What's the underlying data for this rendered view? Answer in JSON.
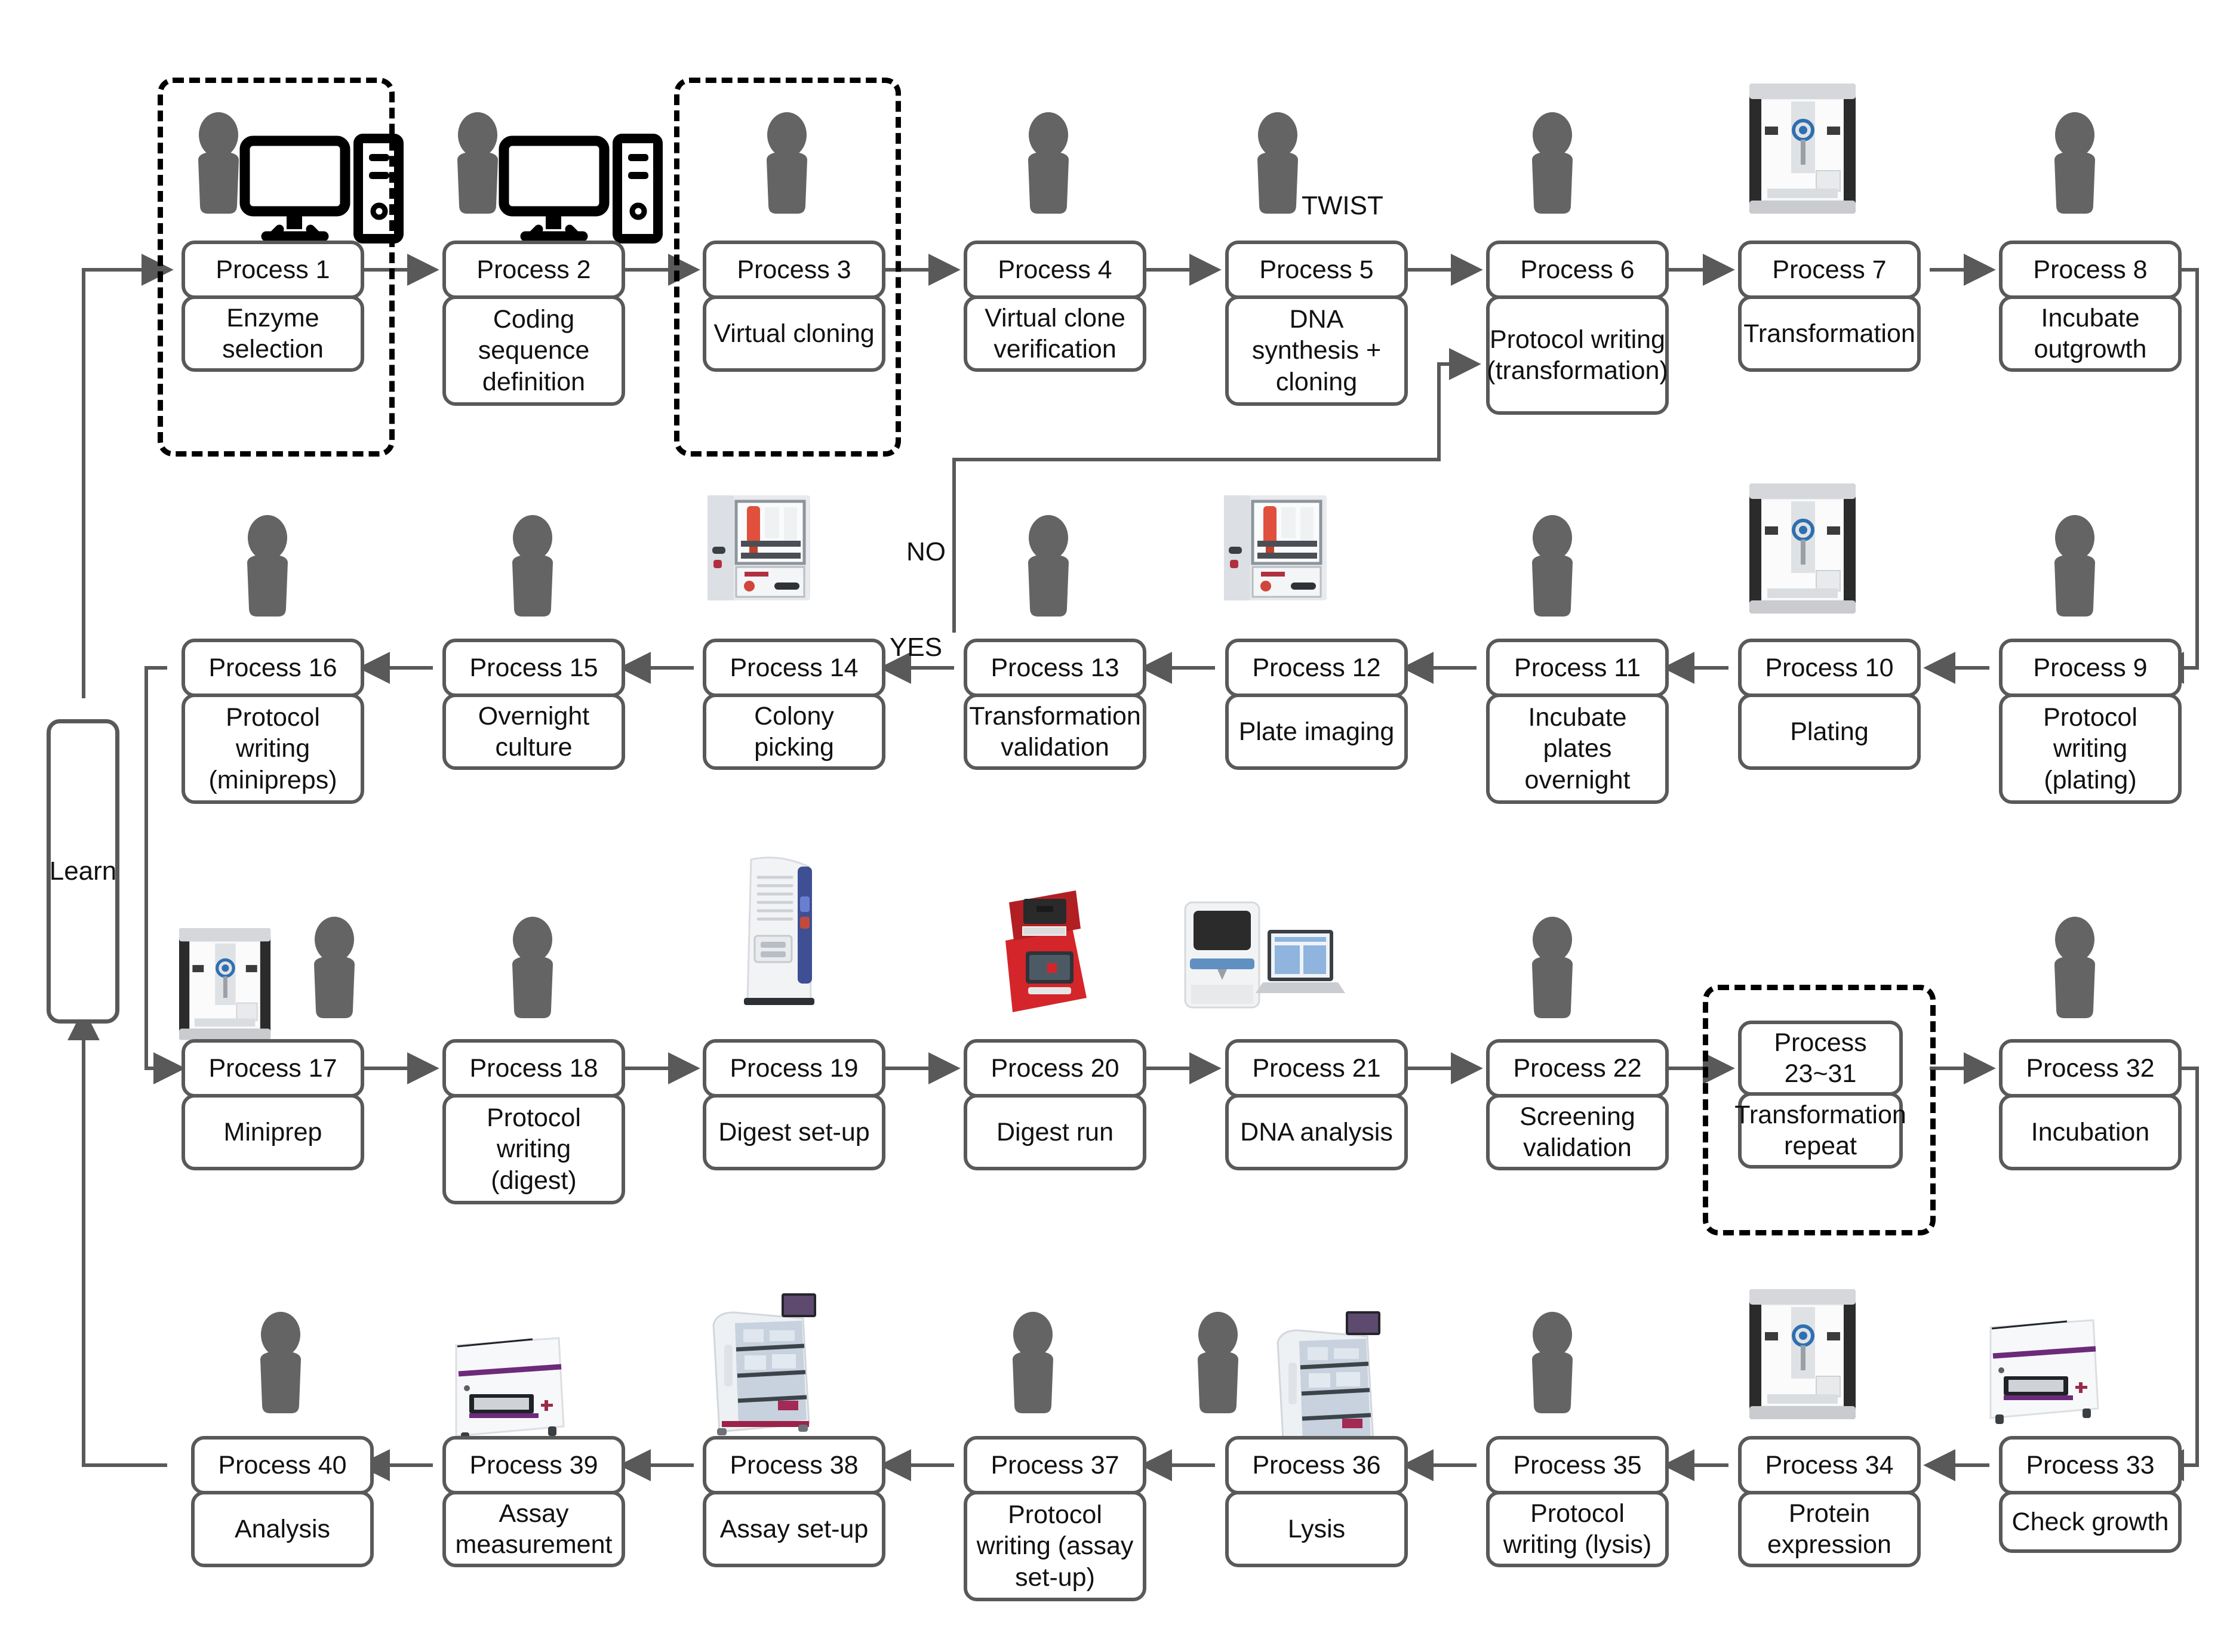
{
  "diagram": {
    "title": "Automated protein engineering workflow (Process 1 - Process 40)",
    "colors": {
      "box_border": "#595959",
      "box_fill": "#FFFFFF",
      "group_border": "#000000",
      "arrow": "#595959",
      "person_icon": "#646464",
      "text": "#111111"
    },
    "learn": {
      "label": "Learn"
    },
    "annotations": [
      {
        "id": "twist",
        "text": "TWIST"
      },
      {
        "id": "no",
        "text": "NO"
      },
      {
        "id": "yes",
        "text": "YES"
      }
    ],
    "groups": [
      {
        "id": "group-p1",
        "contains": [
          "Process 1"
        ]
      },
      {
        "id": "group-p3",
        "contains": [
          "Process 3"
        ]
      },
      {
        "id": "group-p23-31",
        "contains": [
          "Process 23~31"
        ]
      }
    ],
    "rows": [
      {
        "id": "row-1",
        "direction": "left-to-right",
        "nodes": [
          {
            "id": "p1",
            "title": "Process 1",
            "desc": "Enzyme selection",
            "actor": "person",
            "device": "computer"
          },
          {
            "id": "p2",
            "title": "Process 2",
            "desc": "Coding sequence definition",
            "actor": "person",
            "device": "computer"
          },
          {
            "id": "p3",
            "title": "Process 3",
            "desc": "Virtual cloning",
            "actor": "person",
            "device": "none"
          },
          {
            "id": "p4",
            "title": "Process 4",
            "desc": "Virtual clone verification",
            "actor": "person",
            "device": "none"
          },
          {
            "id": "p5",
            "title": "Process 5",
            "desc": "DNA synthesis + cloning",
            "actor": "person",
            "device": "none",
            "note": "TWIST"
          },
          {
            "id": "p6",
            "title": "Process 6",
            "desc": "Protocol writing (transformation)",
            "actor": "person",
            "device": "none"
          },
          {
            "id": "p7",
            "title": "Process 7",
            "desc": "Transformation",
            "actor": "none",
            "device": "opentrons"
          },
          {
            "id": "p8",
            "title": "Process 8",
            "desc": "Incubate outgrowth",
            "actor": "person",
            "device": "none"
          }
        ]
      },
      {
        "id": "row-2",
        "direction": "right-to-left",
        "nodes": [
          {
            "id": "p9",
            "title": "Process 9",
            "desc": "Protocol writing (plating)",
            "actor": "person",
            "device": "none"
          },
          {
            "id": "p10",
            "title": "Process 10",
            "desc": "Plating",
            "actor": "none",
            "device": "opentrons"
          },
          {
            "id": "p11",
            "title": "Process 11",
            "desc": "Incubate plates overnight",
            "actor": "person",
            "device": "none"
          },
          {
            "id": "p12",
            "title": "Process 12",
            "desc": "Plate imaging",
            "actor": "none",
            "device": "pixl"
          },
          {
            "id": "p13",
            "title": "Process 13",
            "desc": "Transformation validation",
            "actor": "person",
            "device": "none"
          },
          {
            "id": "p14",
            "title": "Process 14",
            "desc": "Colony picking",
            "actor": "none",
            "device": "pixl"
          },
          {
            "id": "p15",
            "title": "Process 15",
            "desc": "Overnight culture",
            "actor": "person",
            "device": "none"
          },
          {
            "id": "p16",
            "title": "Process 16",
            "desc": "Protocol writing (minipreps)",
            "actor": "person",
            "device": "none"
          }
        ]
      },
      {
        "id": "row-3",
        "direction": "left-to-right",
        "nodes": [
          {
            "id": "p17",
            "title": "Process 17",
            "desc": "Miniprep",
            "actor": "person",
            "device": "opentrons"
          },
          {
            "id": "p18",
            "title": "Process 18",
            "desc": "Protocol writing (digest)",
            "actor": "person",
            "device": "none"
          },
          {
            "id": "p19",
            "title": "Process 19",
            "desc": "Digest set-up",
            "actor": "none",
            "device": "pipette-tower"
          },
          {
            "id": "p20",
            "title": "Process 20",
            "desc": "Digest run",
            "actor": "none",
            "device": "thermocycler"
          },
          {
            "id": "p21",
            "title": "Process 21",
            "desc": "DNA analysis",
            "actor": "none",
            "device": "analyzer-laptop"
          },
          {
            "id": "p22",
            "title": "Process 22",
            "desc": "Screening validation",
            "actor": "person",
            "device": "none"
          },
          {
            "id": "p23",
            "title": "Process 23~31",
            "desc": "Transformation repeat",
            "actor": "none",
            "device": "none"
          },
          {
            "id": "p32",
            "title": "Process 32",
            "desc": "Incubation",
            "actor": "person",
            "device": "none"
          }
        ]
      },
      {
        "id": "row-4",
        "direction": "right-to-left",
        "nodes": [
          {
            "id": "p33",
            "title": "Process 33",
            "desc": "Check growth",
            "actor": "none",
            "device": "clariostar"
          },
          {
            "id": "p34",
            "title": "Process 34",
            "desc": "Protein expression",
            "actor": "none",
            "device": "opentrons"
          },
          {
            "id": "p35",
            "title": "Process 35",
            "desc": "Protocol writing (lysis)",
            "actor": "person",
            "device": "none"
          },
          {
            "id": "p36",
            "title": "Process 36",
            "desc": "Lysis",
            "actor": "person",
            "device": "incubator-shaker"
          },
          {
            "id": "p37",
            "title": "Process 37",
            "desc": "Protocol writing (assay set-up)",
            "actor": "person",
            "device": "none"
          },
          {
            "id": "p38",
            "title": "Process 38",
            "desc": "Assay set-up",
            "actor": "none",
            "device": "incubator-shaker"
          },
          {
            "id": "p39",
            "title": "Process 39",
            "desc": "Assay measurement",
            "actor": "none",
            "device": "clariostar"
          },
          {
            "id": "p40",
            "title": "Process 40",
            "desc": "Analysis",
            "actor": "person",
            "device": "none"
          }
        ]
      }
    ]
  }
}
